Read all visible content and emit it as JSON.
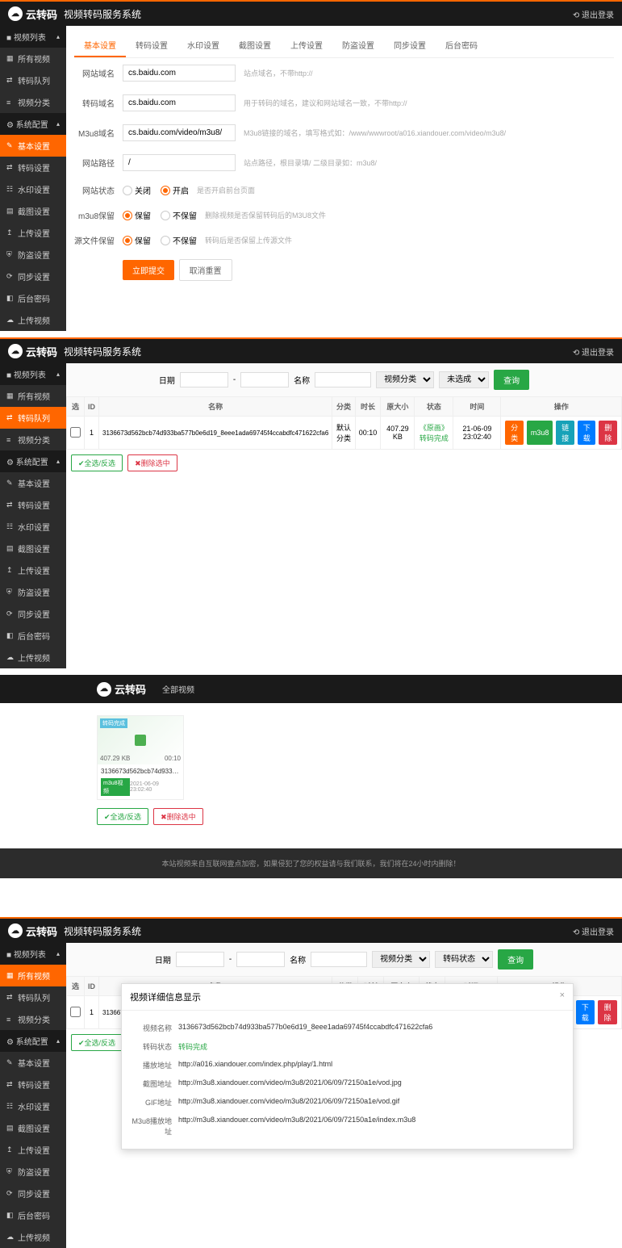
{
  "brand": "云转码",
  "header_title": "视频转码服务系统",
  "logout": "退出登录",
  "sidebar_groups": {
    "video_list": "视频列表",
    "system_config": "系统配置"
  },
  "sidebar_items": {
    "all_videos": "所有视频",
    "transcode_queue": "转码队列",
    "video_category": "视频分类",
    "basic_settings": "基本设置",
    "transcode_settings": "转码设置",
    "watermark_settings": "水印设置",
    "screenshot_settings": "截图设置",
    "upload_settings": "上传设置",
    "security_settings": "防盗设置",
    "sync_settings": "同步设置",
    "backend_code": "后台密码",
    "upload_video": "上传视频"
  },
  "tabs": {
    "basic": "基本设置",
    "transcode": "转码设置",
    "watermark": "水印设置",
    "screenshot": "截图设置",
    "upload": "上传设置",
    "security": "防盗设置",
    "sync": "同步设置",
    "backend": "后台密码"
  },
  "form": {
    "site_domain": {
      "label": "网站域名",
      "value": "cs.baidu.com",
      "hint": "站点域名，不带http://"
    },
    "transcode_domain": {
      "label": "转码域名",
      "value": "cs.baidu.com",
      "hint": "用于转码的域名，建议和网站域名一致，不带http://"
    },
    "m3u8_domain": {
      "label": "M3u8域名",
      "value": "cs.baidu.com/video/m3u8/",
      "hint": "M3u8链接的域名，填写格式如：/www/wwwroot/a016.xiandouer.com/video/m3u8/"
    },
    "site_path": {
      "label": "网站路径",
      "value": "/",
      "hint": "站点路径，根目录填/ 二级目录如：m3u8/"
    },
    "site_status": {
      "label": "网站状态",
      "opt_off": "关闭",
      "opt_on": "开启",
      "hint": "是否开启前台页面"
    },
    "m3u8_keep": {
      "label": "m3u8保留",
      "opt_keep": "保留",
      "opt_nokeep": "不保留",
      "hint": "删除视频是否保留转码后的M3U8文件"
    },
    "source_keep": {
      "label": "源文件保留",
      "opt_keep": "保留",
      "opt_nokeep": "不保留",
      "hint": "转码后是否保留上传源文件"
    },
    "submit": "立即提交",
    "reset": "取消重置"
  },
  "filter": {
    "date": "日期",
    "name": "名称",
    "category_placeholder": "视频分类",
    "status_placeholder": "未选成",
    "status2_placeholder": "转码状态",
    "search": "查询"
  },
  "table": {
    "headers": {
      "sel": "选",
      "id": "ID",
      "name": "名称",
      "category": "分类",
      "duration": "时长",
      "size": "原大小",
      "status": "状态",
      "time": "时间",
      "action": "操作"
    },
    "row": {
      "id": "1",
      "name": "3136673d562bcb74d933ba577b0e6d19_8eee1ada69745f4ccabdfc471622cfa6",
      "category": "默认分类",
      "duration": "00:10",
      "size": "407.29 KB",
      "status_p2": "《原画》转码完成",
      "status_p4": "转码完成",
      "time": "21-06-09 23:02:40"
    },
    "actions": {
      "cat": "分类",
      "m3u8": "m3u8",
      "link": "链接",
      "down": "下载",
      "del": "删除"
    }
  },
  "sel_actions": {
    "all": "全选/反选",
    "del": "删除选中"
  },
  "panel3": {
    "nav_all": "全部视频",
    "card": {
      "badge": "转码完成",
      "size": "407.29 KB",
      "duration": "00:10",
      "name": "3136673d562bcb74d933ba5...",
      "tag": "m3u8视频",
      "date": "2021-06-09 23:02:40"
    },
    "footer": "本站视频来自互联网壹点加密，如果侵犯了您的权益请与我们联系，我们将在24小时内删除！"
  },
  "modal": {
    "title": "视频详细信息显示",
    "rows": {
      "name": {
        "label": "视频名称",
        "value": "3136673d562bcb74d933ba577b0e6d19_8eee1ada69745f4ccabdfc471622cfa6"
      },
      "status": {
        "label": "转码状态",
        "value": "转码完成"
      },
      "play": {
        "label": "播放地址",
        "value": "http://a016.xiandouer.com/index.php/play/1.html"
      },
      "cover": {
        "label": "截图地址",
        "value": "http://m3u8.xiandouer.com/video/m3u8/2021/06/09/72150a1e/vod.jpg"
      },
      "gif": {
        "label": "GIF地址",
        "value": "http://m3u8.xiandouer.com/video/m3u8/2021/06/09/72150a1e/vod.gif"
      },
      "m3u8": {
        "label": "M3u8播放地址",
        "value": "http://m3u8.xiandouer.com/video/m3u8/2021/06/09/72150a1e/index.m3u8"
      }
    }
  }
}
